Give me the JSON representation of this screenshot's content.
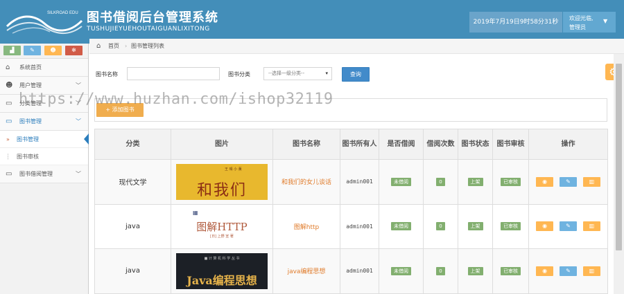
{
  "header": {
    "logo_text": "SILKROAD EDU",
    "title": "图书借阅后台管理系统",
    "subtitle": "TUSHUJIEYUEHOUTAIGUANLIXITONG",
    "datetime": "2019年7月19日9时58分31秒",
    "welcome": "欢迎光临,",
    "role": "管理员",
    "colors": {
      "bar": "#438eb9",
      "user_box": "#62a8d1"
    }
  },
  "sidebar": {
    "shortcuts": [
      {
        "icon": "chart-icon",
        "glyph": "▟",
        "color": "#87b87f"
      },
      {
        "icon": "pencil-icon",
        "glyph": "✎",
        "color": "#6fb3e0"
      },
      {
        "icon": "users-icon",
        "glyph": "☻",
        "color": "#ffb752"
      },
      {
        "icon": "gears-icon",
        "glyph": "✻",
        "color": "#d15b47"
      }
    ],
    "items": [
      {
        "label": "系统首页",
        "icon": "home-icon",
        "glyph": "⌂"
      },
      {
        "label": "用户管理",
        "icon": "users-icon",
        "glyph": "☻"
      },
      {
        "label": "分类管理",
        "icon": "desktop-icon",
        "glyph": "▭"
      },
      {
        "label": "图书管理",
        "icon": "desktop-icon",
        "glyph": "▭"
      },
      {
        "label": "图书借阅管理",
        "icon": "desktop-icon",
        "glyph": "▭"
      }
    ],
    "subitems": [
      {
        "label": "图书管理",
        "active": true
      },
      {
        "label": "图书审核",
        "active": false
      }
    ]
  },
  "breadcrumb": {
    "home": "首页",
    "current": "图书管理列表"
  },
  "search": {
    "name_label": "图书名称",
    "name_value": "",
    "category_label": "图书分类",
    "category_selected": "--选择一级分类--",
    "search_button": "查询"
  },
  "toolbar": {
    "add_button": "+ 添加图书"
  },
  "watermark": "https://www.huzhan.com/ishop32119",
  "table": {
    "headers": [
      "分类",
      "图片",
      "图书名称",
      "图书所有人",
      "是否借阅",
      "借阅次数",
      "图书状态",
      "图书审核",
      "操作"
    ],
    "rows": [
      {
        "category": "现代文学",
        "cover": {
          "top": "王 晴 小 薰",
          "main": "和我们",
          "bg": "#e8b82e",
          "fg": "#8b2d14"
        },
        "name": "和我们的女儿谈话",
        "owner": "admin001",
        "borrowed": "未借阅",
        "count": "0",
        "status": "上架",
        "audit": "已审核"
      },
      {
        "category": "java",
        "cover": {
          "top": "▦",
          "main": "图解HTTP",
          "sub": "[日] 上野 宣 著",
          "bg": "#ffffff",
          "fg": "#b05a3c"
        },
        "name": "图解http",
        "owner": "admin001",
        "borrowed": "未借阅",
        "count": "0",
        "status": "上架",
        "audit": "已审核"
      },
      {
        "category": "java",
        "cover": {
          "top": "■ 计 算 机 科 学 丛 书",
          "main": "Java编程思想",
          "bg": "#1c2026",
          "fg": "#e6b34a"
        },
        "name": "java编程思想",
        "owner": "admin001",
        "borrowed": "未借阅",
        "count": "0",
        "status": "上架",
        "audit": "已审核"
      }
    ],
    "actions": [
      {
        "icon": "eye-icon",
        "glyph": "◉"
      },
      {
        "icon": "edit-icon",
        "glyph": "✎"
      },
      {
        "icon": "trash-icon",
        "glyph": "▥"
      }
    ]
  }
}
